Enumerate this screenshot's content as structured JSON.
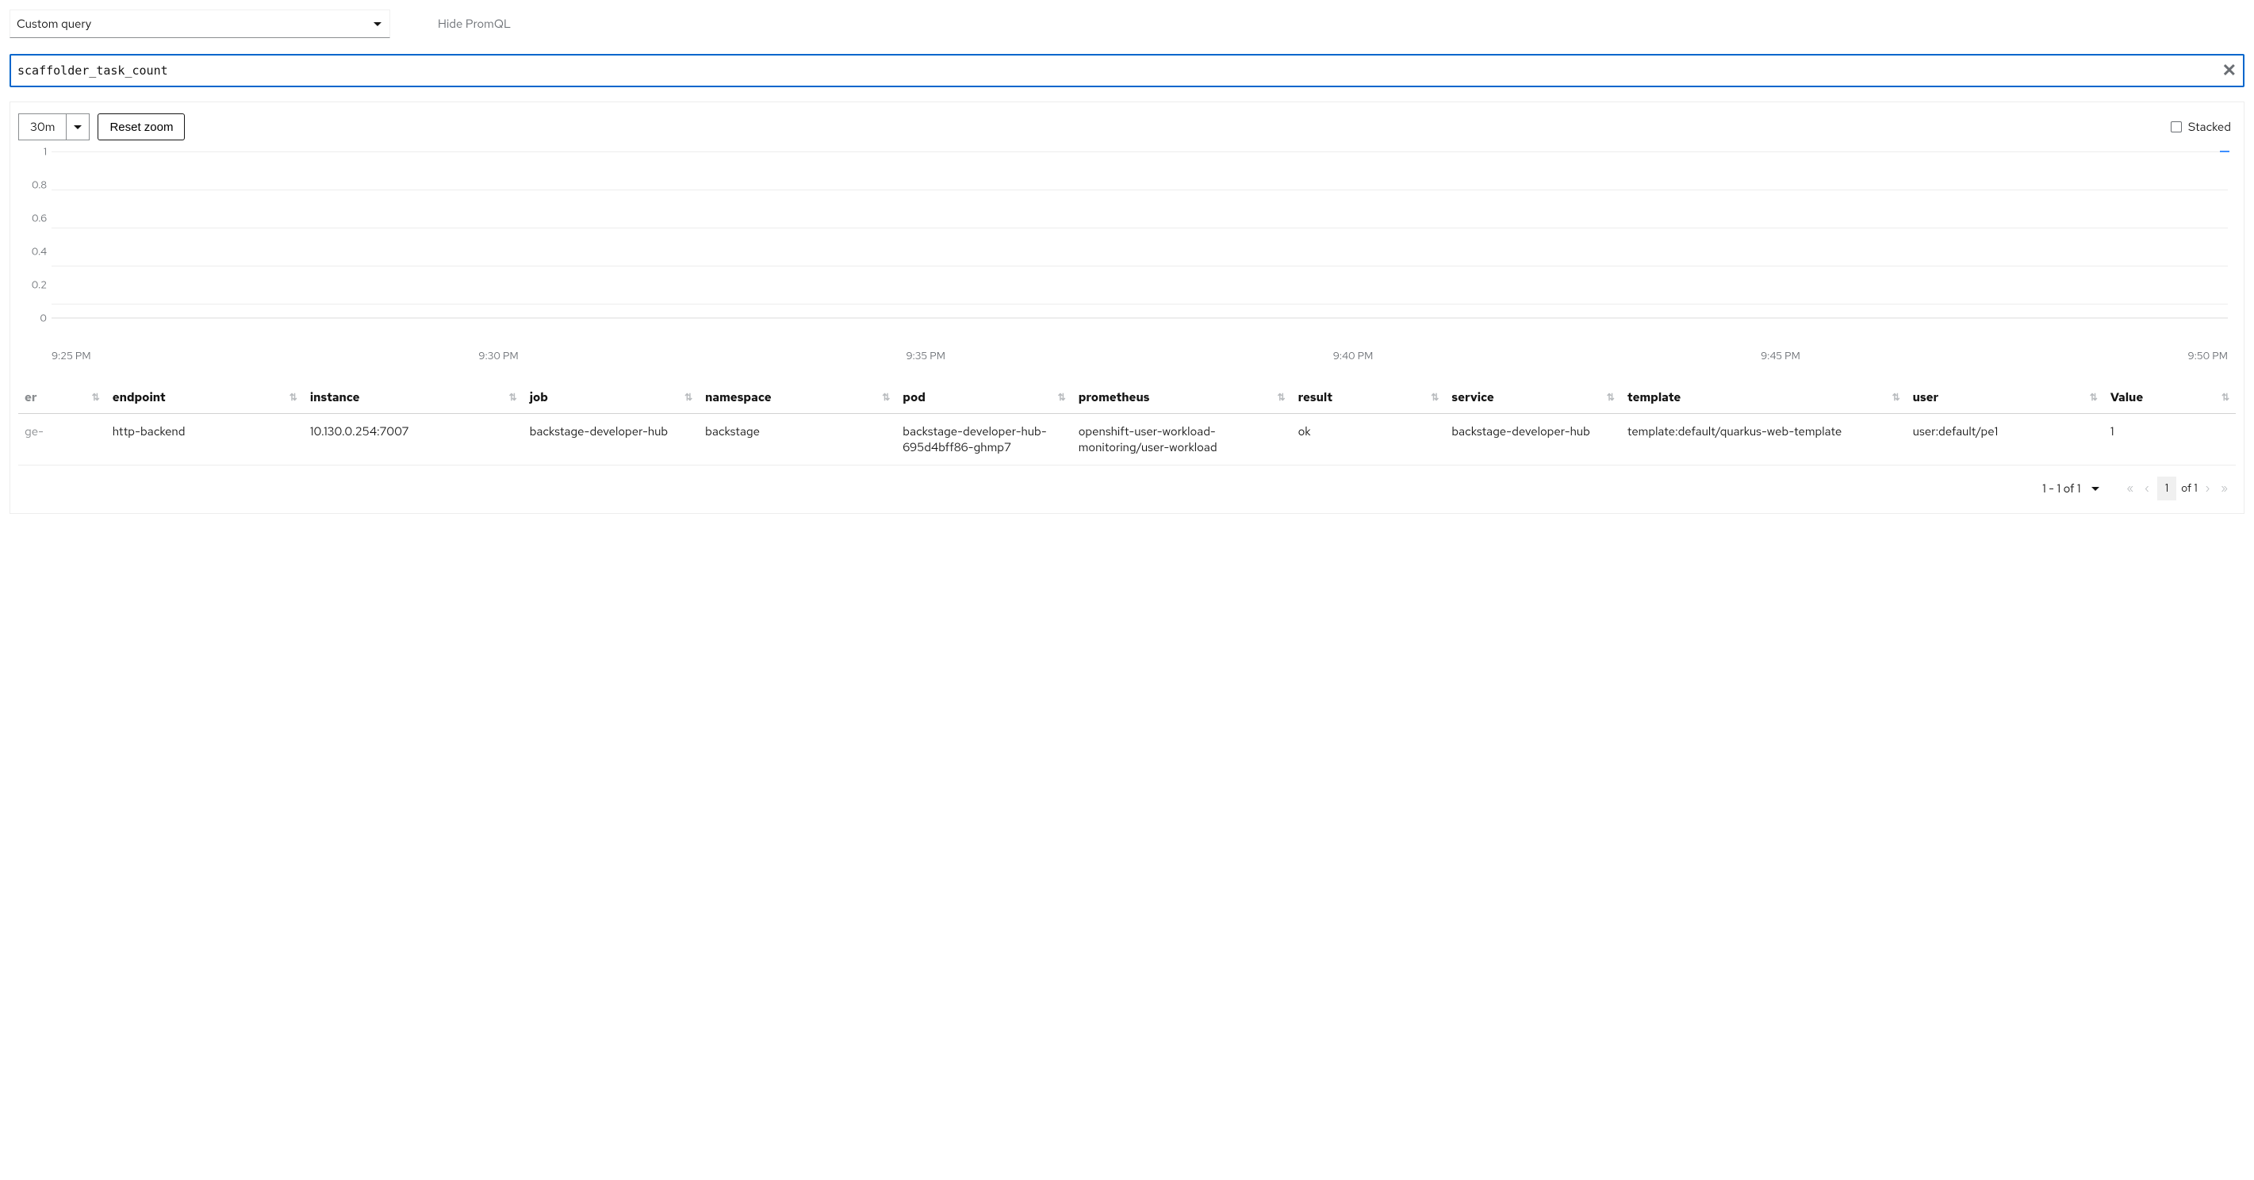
{
  "query_type_label": "Custom query",
  "hide_promql_label": "Hide PromQL",
  "query_input_value": "scaffolder_task_count",
  "time_range": "30m",
  "reset_zoom_label": "Reset zoom",
  "stacked_label": "Stacked",
  "chart_data": {
    "type": "line",
    "ylim": [
      0,
      1
    ],
    "y_ticks": [
      "1",
      "0.8",
      "0.6",
      "0.4",
      "0.2",
      "0"
    ],
    "x_ticks": [
      "9:25 PM",
      "9:30 PM",
      "9:35 PM",
      "9:40 PM",
      "9:45 PM",
      "9:50 PM"
    ],
    "series": [
      {
        "name": "scaffolder_task_count",
        "color": "#3e8fff",
        "values": [
          1
        ]
      }
    ]
  },
  "table": {
    "columns_partial_left": "er",
    "columns": [
      "endpoint",
      "instance",
      "job",
      "namespace",
      "pod",
      "prometheus",
      "result",
      "service",
      "template",
      "user",
      "Value"
    ],
    "rows": [
      {
        "partial_left": "ge-",
        "endpoint": "http-backend",
        "instance": "10.130.0.254:7007",
        "job": "backstage-developer-hub",
        "namespace": "backstage",
        "pod": "backstage-developer-hub-695d4bff86-ghmp7",
        "prometheus": "openshift-user-workload-monitoring/user-workload",
        "result": "ok",
        "service": "backstage-developer-hub",
        "template": "template:default/quarkus-web-template",
        "user": "user:default/pe1",
        "value": "1"
      }
    ]
  },
  "pagination": {
    "range": "1 - 1 of 1",
    "page": "1",
    "total": "of 1"
  }
}
